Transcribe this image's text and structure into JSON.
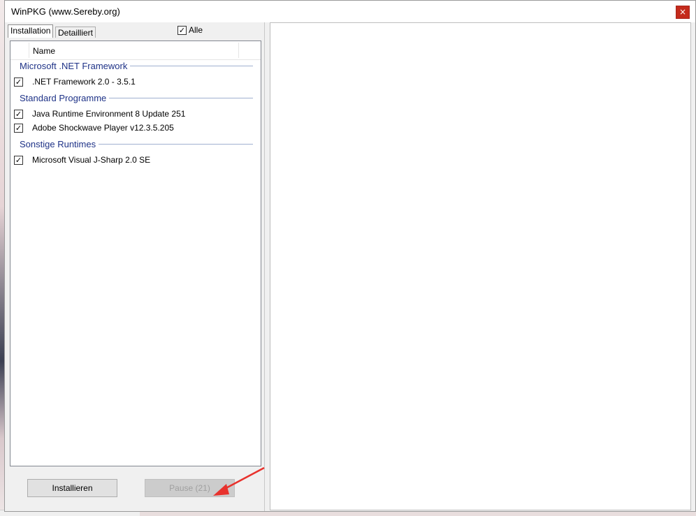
{
  "window": {
    "title": "WinPKG (www.Sereby.org)",
    "close_glyph": "×"
  },
  "tabs": [
    {
      "label": "Installation",
      "active": true
    },
    {
      "label": "Detailliert",
      "active": false
    }
  ],
  "select_all": {
    "label": "Alle",
    "checked": true
  },
  "list": {
    "column_name": "Name",
    "groups": [
      {
        "title": "Microsoft .NET Framework",
        "items": [
          {
            "label": ".NET Framework 2.0 - 3.5.1",
            "checked": true
          }
        ]
      },
      {
        "title": "Standard Programme",
        "items": [
          {
            "label": "Java Runtime Environment 8 Update 251",
            "checked": true
          },
          {
            "label": "Adobe Shockwave Player v12.3.5.205",
            "checked": true
          }
        ]
      },
      {
        "title": "Sonstige Runtimes",
        "items": [
          {
            "label": "Microsoft Visual J-Sharp 2.0 SE",
            "checked": true
          }
        ]
      }
    ]
  },
  "buttons": {
    "install_label": "Installieren",
    "pause_label": "Pause (21)"
  },
  "colors": {
    "group_title": "#1e3287",
    "close_button": "#c42b1c",
    "annotation_arrow": "#e8322d"
  },
  "icons": {
    "checkmark": "✓",
    "annotation": "red-arrow-icon"
  }
}
